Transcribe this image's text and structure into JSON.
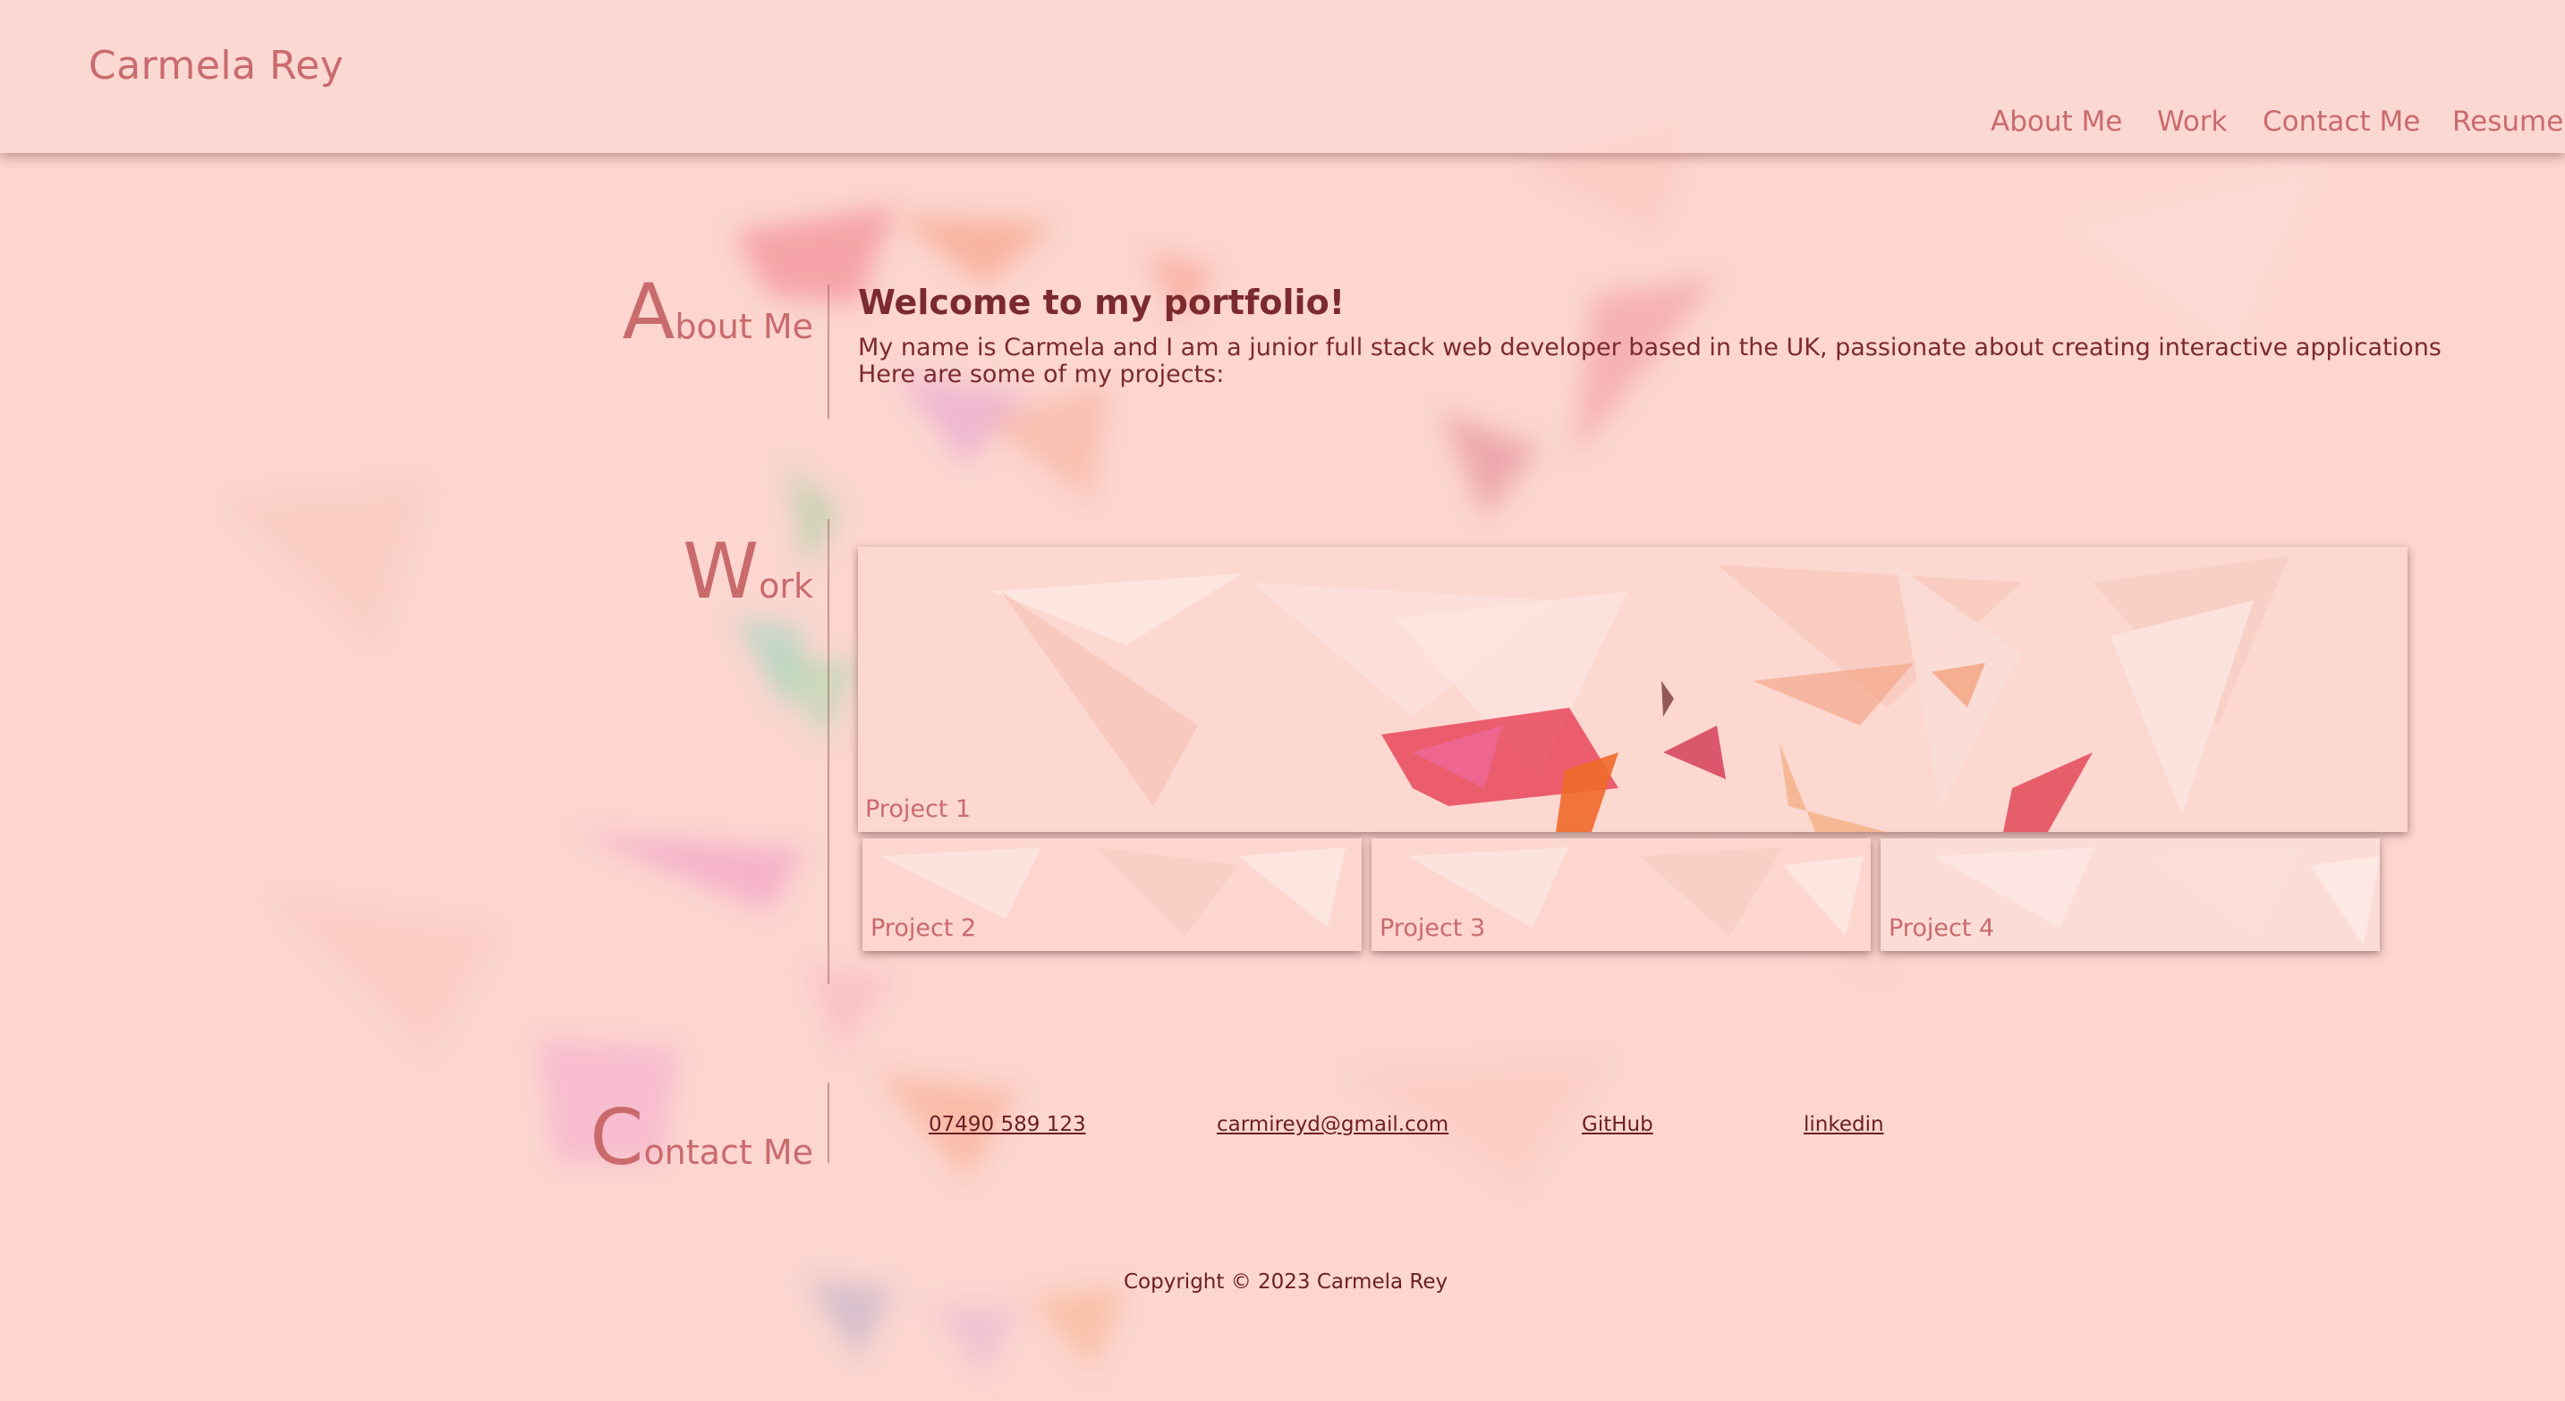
{
  "header": {
    "brand": "Carmela Rey",
    "nav": [
      {
        "label": "About Me"
      },
      {
        "label": "Work"
      },
      {
        "label": "Contact Me"
      },
      {
        "label": "Resume"
      }
    ]
  },
  "about": {
    "title_cap": "A",
    "title_rest": "bout Me",
    "heading": "Welcome to my portfolio!",
    "line1": "My name is Carmela and I am a junior full stack web developer based in the UK, passionate about creating interactive applications",
    "line2": "Here are some of my projects:"
  },
  "work": {
    "title_cap": "W",
    "title_rest": "ork",
    "projects": [
      {
        "label": "Project 1"
      },
      {
        "label": "Project 2"
      },
      {
        "label": "Project 3"
      },
      {
        "label": "Project 4"
      }
    ]
  },
  "contact": {
    "title_cap": "C",
    "title_rest": "ontact Me",
    "phone": "07490 589 123",
    "email": "carmireyd@gmail.com",
    "github": "GitHub",
    "linkedin": "linkedin"
  },
  "footer": {
    "copyright": "Copyright © 2023 Carmela Rey"
  },
  "colors": {
    "background": "#fcd6cf",
    "accent": "#c96b6d",
    "text_dark": "#7b2a30"
  }
}
